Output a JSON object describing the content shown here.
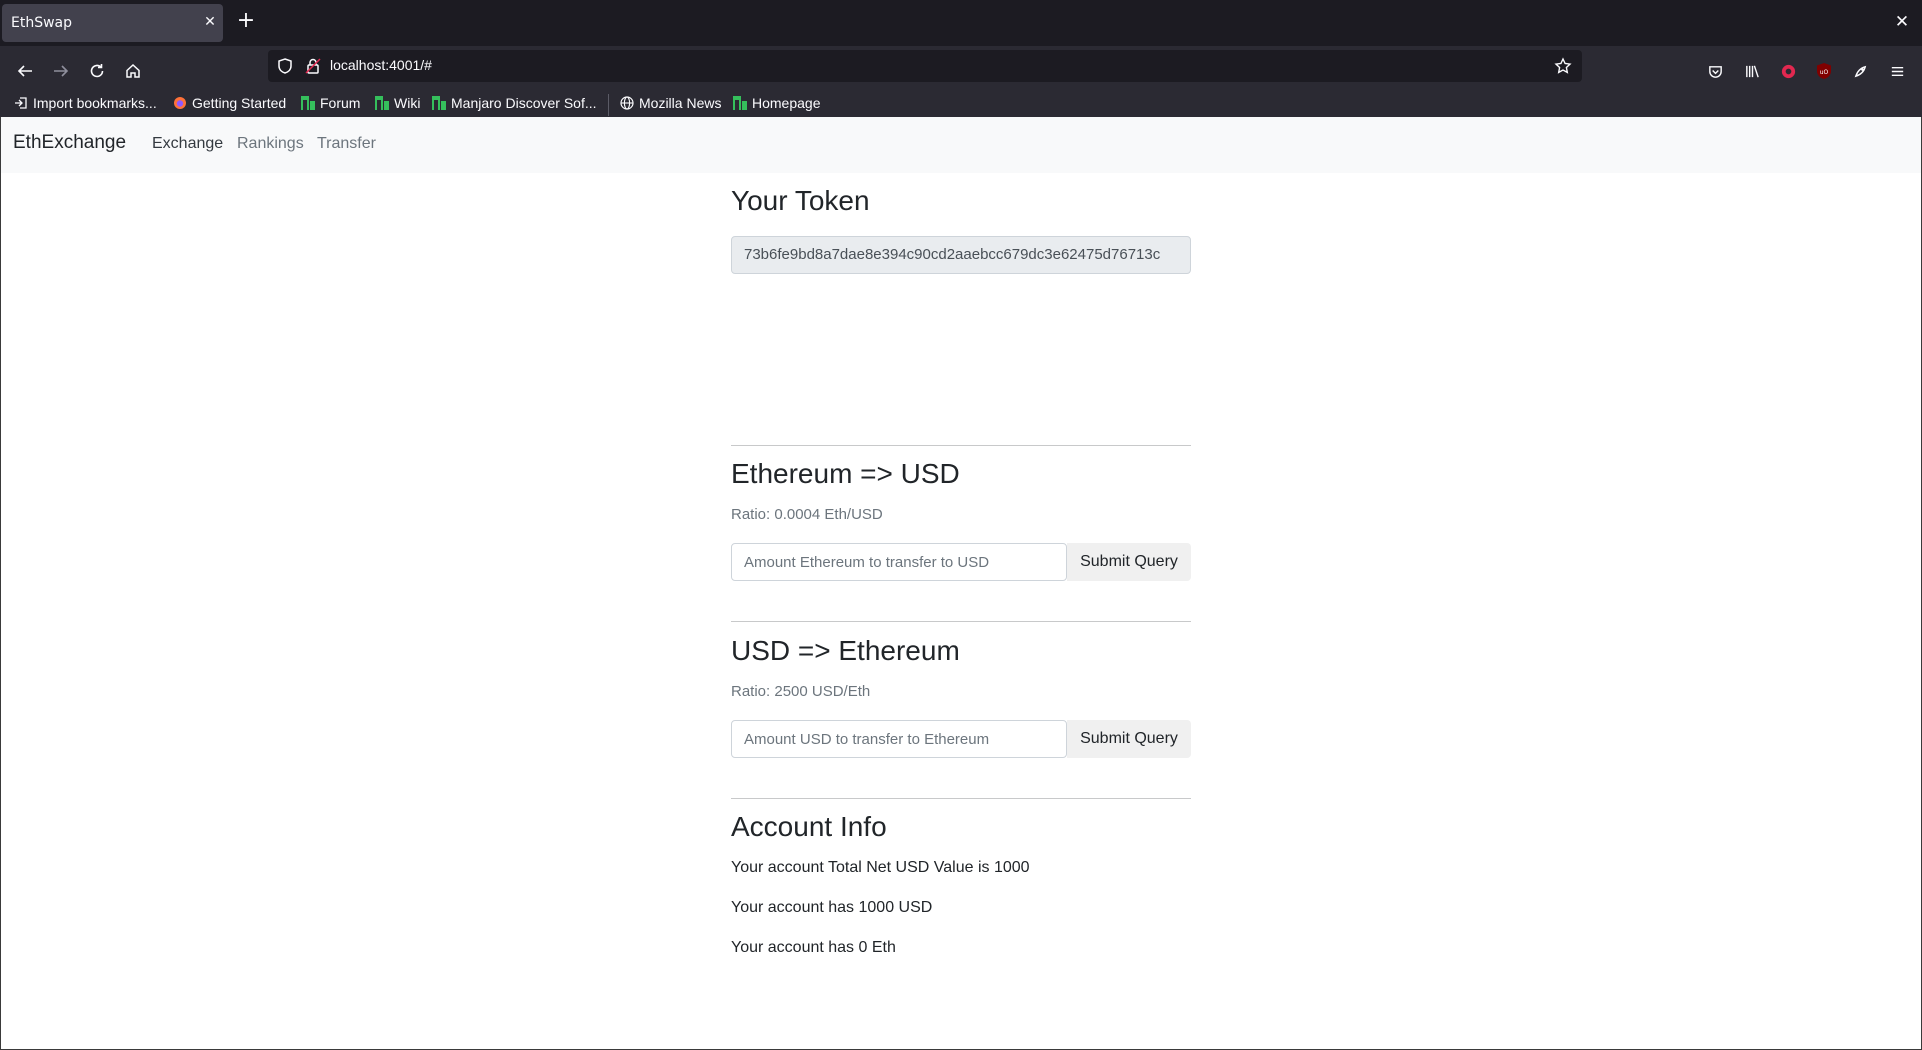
{
  "browser": {
    "tab_title": "EthSwap",
    "url": "localhost:4001/#",
    "bookmarks": [
      {
        "label": "Import bookmarks...",
        "icon": "import-icon"
      },
      {
        "label": "Getting Started",
        "icon": "firefox-icon"
      },
      {
        "label": "Forum",
        "icon": "manjaro-icon"
      },
      {
        "label": "Wiki",
        "icon": "manjaro-icon"
      },
      {
        "label": "Manjaro Discover Sof...",
        "icon": "manjaro-icon"
      },
      {
        "label": "Mozilla News",
        "icon": "globe-icon"
      },
      {
        "label": "Homepage",
        "icon": "manjaro-icon"
      }
    ],
    "colors": {
      "chrome_dark": "#1c1b22",
      "toolbar": "#2b2a33",
      "manjaro_green": "#35bf5c",
      "ublock_red": "#800000"
    }
  },
  "app": {
    "brand": "EthExchange",
    "nav": {
      "exchange": "Exchange",
      "rankings": "Rankings",
      "transfer": "Transfer"
    }
  },
  "token": {
    "heading": "Your Token",
    "value": "73b6fe9bd8a7dae8e394c90cd2aaebcc679dc3e62475d76713c"
  },
  "eth_to_usd": {
    "heading": "Ethereum => USD",
    "ratio": "Ratio: 0.0004 Eth/USD",
    "placeholder": "Amount Ethereum to transfer to USD",
    "submit": "Submit Query"
  },
  "usd_to_eth": {
    "heading": "USD => Ethereum",
    "ratio": "Ratio: 2500 USD/Eth",
    "placeholder": "Amount USD to transfer to Ethereum",
    "submit": "Submit Query"
  },
  "account": {
    "heading": "Account Info",
    "net_value": "Your account Total Net USD Value is 1000",
    "usd": "Your account has 1000 USD",
    "eth": "Your account has 0 Eth"
  }
}
